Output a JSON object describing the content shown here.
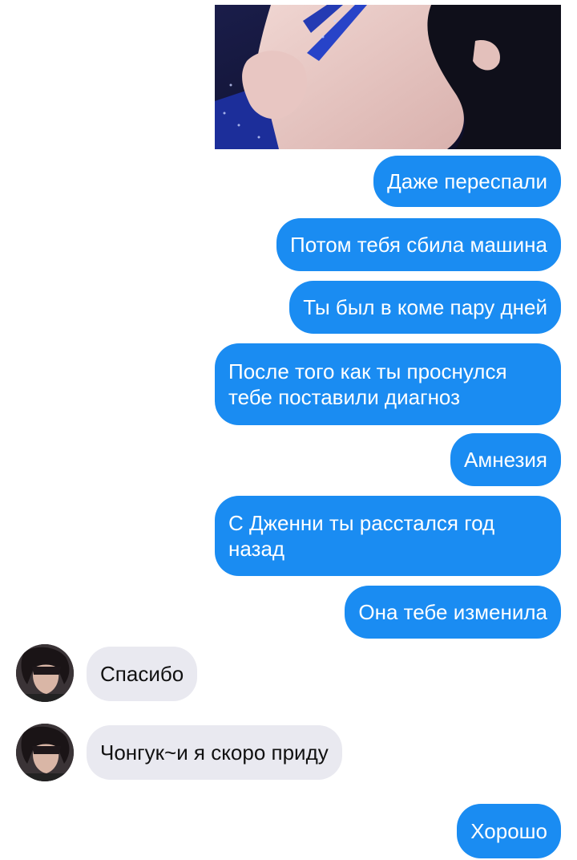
{
  "colors": {
    "outgoing_bubble": "#1a8cf2",
    "incoming_bubble": "#e9e9f0",
    "outgoing_text": "#ffffff",
    "incoming_text": "#111111"
  },
  "messages": [
    {
      "direction": "outgoing",
      "type": "image"
    },
    {
      "direction": "outgoing",
      "text": "Даже переспали"
    },
    {
      "direction": "outgoing",
      "text": "Потом тебя сбила машина"
    },
    {
      "direction": "outgoing",
      "text": "Ты был в коме пару дней"
    },
    {
      "direction": "outgoing",
      "text": "После того как ты проснулся тебе поставили диагноз"
    },
    {
      "direction": "outgoing",
      "text": "Амнезия"
    },
    {
      "direction": "outgoing",
      "text": "С Дженни ты расстался год назад"
    },
    {
      "direction": "outgoing",
      "text": "Она тебе изменила"
    },
    {
      "direction": "incoming",
      "text": "Спасибо"
    },
    {
      "direction": "incoming",
      "text": "Чонгук~и я скоро приду"
    },
    {
      "direction": "outgoing",
      "text": "Хорошо"
    }
  ]
}
